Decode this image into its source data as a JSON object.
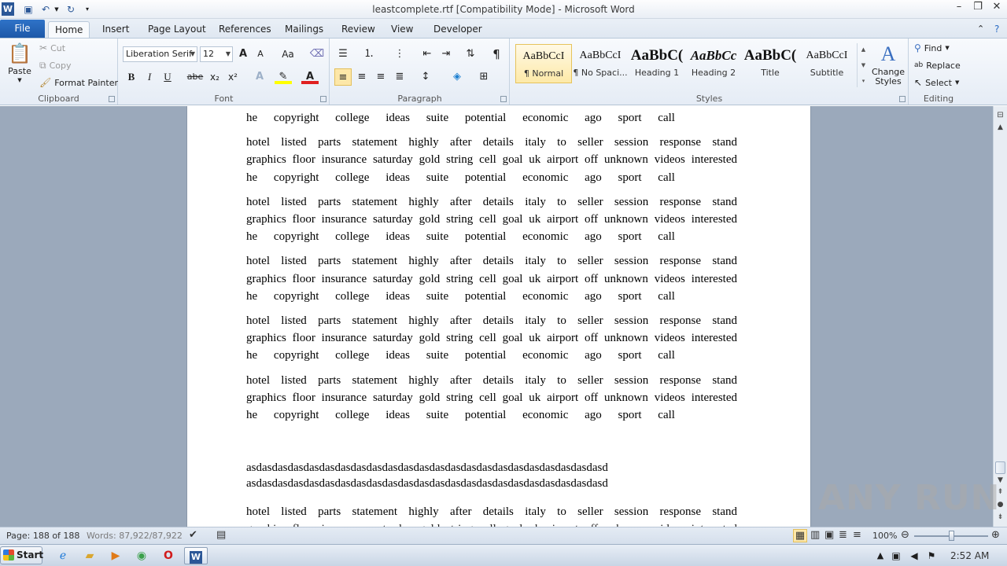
{
  "window": {
    "title": "leastcomplete.rtf [Compatibility Mode]  -  Microsoft Word",
    "app_icon": "W"
  },
  "tabs": [
    "File",
    "Home",
    "Insert",
    "Page Layout",
    "References",
    "Mailings",
    "Review",
    "View",
    "Developer"
  ],
  "clipboard": {
    "paste": "Paste",
    "cut": "Cut",
    "copy": "Copy",
    "format_painter": "Format Painter",
    "label": "Clipboard"
  },
  "font": {
    "family": "Liberation Serif",
    "size": "12",
    "label": "Font",
    "bold": "B",
    "italic": "I",
    "underline": "U",
    "strike": "abe",
    "subscript": "x₂",
    "superscript": "x²",
    "grow": "A",
    "shrink": "A",
    "case": "Aa"
  },
  "paragraph": {
    "label": "Paragraph",
    "pilcrow": "¶"
  },
  "styles": {
    "label": "Styles",
    "items": [
      {
        "sample": "AaBbCcI",
        "name": "¶ Normal"
      },
      {
        "sample": "AaBbCcI",
        "name": "¶ No Spaci..."
      },
      {
        "sample": "AaBbC(",
        "name": "Heading 1"
      },
      {
        "sample": "AaBbCc",
        "name": "Heading 2"
      },
      {
        "sample": "AaBbC(",
        "name": "Title"
      },
      {
        "sample": "AaBbCcI",
        "name": "Subtitle"
      }
    ],
    "change_styles": "Change Styles"
  },
  "editing": {
    "label": "Editing",
    "find": "Find",
    "replace": "Replace",
    "select": "Select"
  },
  "document": {
    "para_line1": "hotel listed parts statement highly after details italy to seller session response stand",
    "para_line2": "graphics floor insurance saturday gold string cell goal uk airport off unknown videos interested",
    "para_line3": "he copyright college ideas suite potential economic ago sport call",
    "asd_line": "asdasdasdasdasdasdasdasdasdasdasdasdasdasdasdasdasdasdasdasdasdasdasd"
  },
  "statusbar": {
    "page": "Page: 188 of 188",
    "words": "Words: 87,922/87,922",
    "zoom": "100%"
  },
  "taskbar": {
    "start": "Start",
    "clock": "2:52 AM"
  },
  "watermark": "ANY RUN"
}
